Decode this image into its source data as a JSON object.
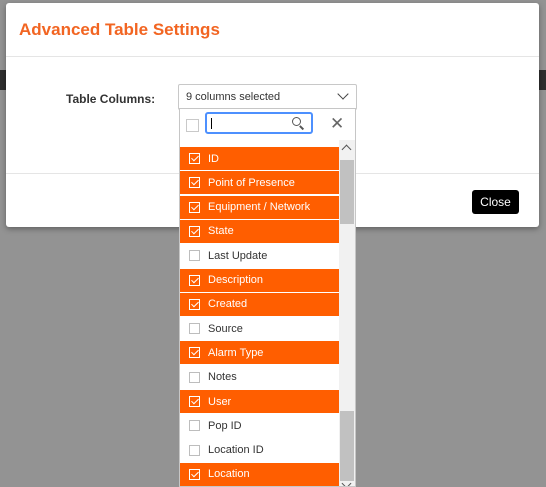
{
  "modal": {
    "title": "Advanced Table Settings",
    "columns_label": "Table Columns:",
    "select_value": "9 columns selected",
    "close_label": "Close"
  },
  "dropdown": {
    "search_value": "",
    "clear_symbol": "✕",
    "items": [
      {
        "label": "ID",
        "selected": true
      },
      {
        "label": "Point of Presence",
        "selected": true
      },
      {
        "label": "Equipment / Network",
        "selected": true
      },
      {
        "label": "State",
        "selected": true
      },
      {
        "label": "Last Update",
        "selected": false
      },
      {
        "label": "Description",
        "selected": true
      },
      {
        "label": "Created",
        "selected": true
      },
      {
        "label": "Source",
        "selected": false
      },
      {
        "label": "Alarm Type",
        "selected": true
      },
      {
        "label": "Notes",
        "selected": false
      },
      {
        "label": "User",
        "selected": true
      },
      {
        "label": "Pop ID",
        "selected": false
      },
      {
        "label": "Location ID",
        "selected": false
      },
      {
        "label": "Location",
        "selected": true
      }
    ]
  },
  "colors": {
    "accent": "#f26522",
    "selected_row": "#ff5e00",
    "overlay": "#939393"
  }
}
